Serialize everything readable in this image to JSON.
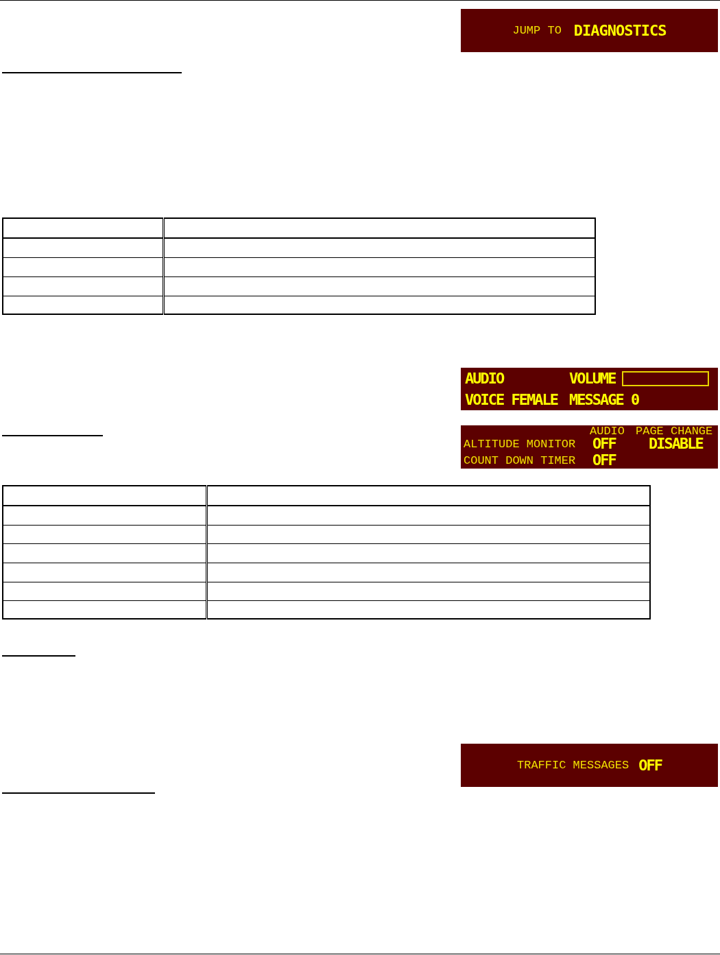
{
  "jump_panel": {
    "label": "JUMP TO",
    "value": "DIAGNOSTICS"
  },
  "audio_panel": {
    "title": "AUDIO",
    "volume": {
      "label": "VOLUME",
      "level": 0
    },
    "voice": "VOICE FEMALE",
    "message": "MESSAGE 0"
  },
  "alerts_panel": {
    "columns": [
      "AUDIO",
      "PAGE CHANGE"
    ],
    "rows": [
      {
        "label": "ALTITUDE MONITOR",
        "audio": "OFF",
        "page_change": "DISABLE"
      },
      {
        "label": "COUNT DOWN TIMER",
        "audio": "OFF"
      }
    ]
  },
  "traffic_panel": {
    "label": "TRAFFIC MESSAGES",
    "value": "OFF"
  }
}
